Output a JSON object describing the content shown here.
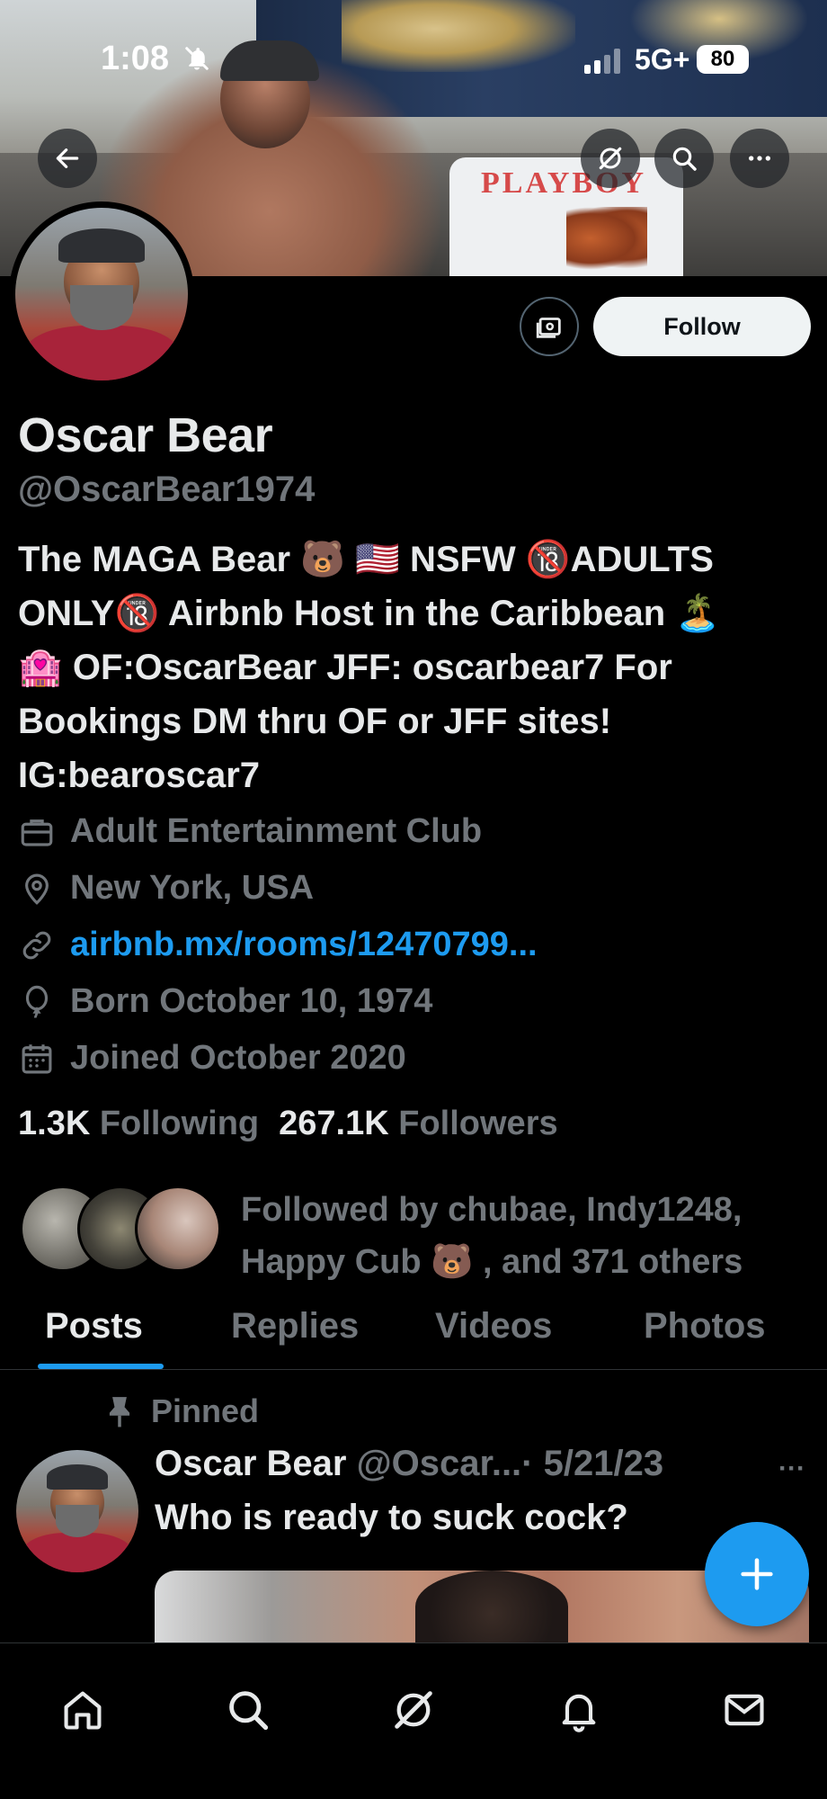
{
  "status_bar": {
    "time": "1:08",
    "network": "5G+",
    "battery": "80"
  },
  "profile": {
    "name": "Oscar Bear",
    "handle": "@OscarBear1974",
    "bio_lines": [
      "The MAGA Bear 🐻 🇺🇸 NSFW 🔞ADULTS",
      "ONLY🔞 Airbnb Host in the Caribbean 🏝️",
      "🏩 OF:OscarBear JFF: oscarbear7 For",
      "Bookings DM thru OF or JFF sites!",
      "IG:bearoscar7"
    ],
    "banner_pillow_text": "PLAYBOY",
    "follow_label": "Follow",
    "category": "Adult Entertainment Club",
    "location": "New York, USA",
    "website": "airbnb.mx/rooms/12470799...",
    "birthday": "Born October 10, 1974",
    "joined": "Joined October 2020",
    "following_count": "1.3K",
    "following_label": "Following",
    "followers_count": "267.1K",
    "followers_label": "Followers",
    "followed_by_line1": "Followed by chubae, Indy1248,",
    "followed_by_line2": "Happy Cub 🐻 , and 371 others"
  },
  "tabs": [
    {
      "label": "Posts",
      "active": true
    },
    {
      "label": "Replies",
      "active": false
    },
    {
      "label": "Videos",
      "active": false
    },
    {
      "label": "Photos",
      "active": false
    }
  ],
  "post": {
    "pinned_label": "Pinned",
    "author_name": "Oscar Bear",
    "author_handle": "@Oscar...",
    "date": "· 5/21/23",
    "more": "···",
    "text": "Who is ready to suck cock?"
  },
  "icons": {
    "back": "arrow-left-icon",
    "grok": "grok-icon",
    "search": "search-icon",
    "more": "more-icon",
    "subscribe": "newsletter-icon",
    "category": "briefcase-icon",
    "location": "location-pin-icon",
    "link": "link-icon",
    "birthday": "balloon-icon",
    "joined": "calendar-icon",
    "pin": "pin-icon",
    "compose": "plus-icon",
    "nav": [
      "home-icon",
      "search-icon",
      "grok-icon",
      "bell-icon",
      "mail-icon"
    ]
  },
  "colors": {
    "accent": "#1d9bf0",
    "background": "#000000",
    "text_primary": "#e7e9ea",
    "text_secondary": "#71767b"
  }
}
